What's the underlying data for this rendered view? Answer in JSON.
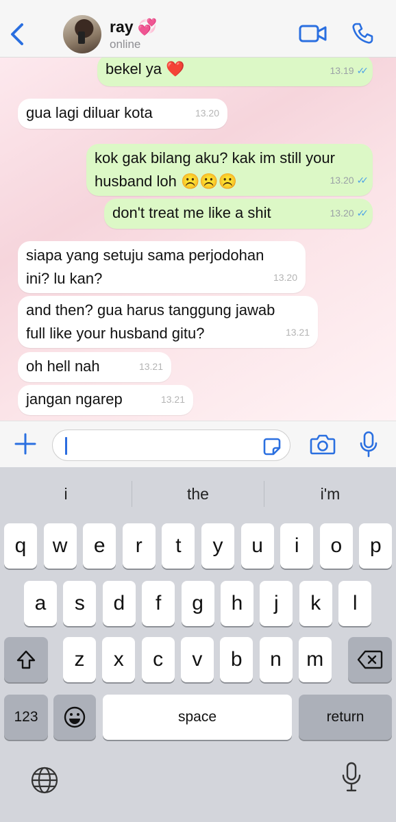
{
  "header": {
    "contact_name": "ray 💞",
    "status": "online",
    "icons": [
      "back-chevron-icon",
      "video-call-icon",
      "phone-call-icon"
    ],
    "accent_color": "#2a6fe0"
  },
  "messages": [
    {
      "side": "out",
      "text": "bekel ya ❤️",
      "time": "13.19",
      "read": true
    },
    {
      "side": "in",
      "text": "gua lagi diluar kota",
      "time": "13.20"
    },
    {
      "side": "out",
      "text": "kok gak bilang aku? kak im still your\nhusband loh ☹️☹️☹️",
      "time": "13.20",
      "read": true
    },
    {
      "side": "out",
      "text": "don't treat me like a shit",
      "time": "13.20",
      "read": true
    },
    {
      "side": "in",
      "text": "siapa yang setuju sama perjodohan\nini? lu kan?",
      "time": "13.20"
    },
    {
      "side": "in",
      "text": "and then? gua harus tanggung jawab\nfull like your husband gitu?",
      "time": "13.21"
    },
    {
      "side": "in",
      "text": "oh hell nah",
      "time": "13.21"
    },
    {
      "side": "in",
      "text": "jangan ngarep",
      "time": "13.21"
    }
  ],
  "input": {
    "value": "",
    "icons": [
      "plus-icon",
      "sticker-icon",
      "camera-icon",
      "microphone-icon"
    ]
  },
  "keyboard": {
    "suggestions": [
      "i",
      "the",
      "i'm"
    ],
    "row1": [
      "q",
      "w",
      "e",
      "r",
      "t",
      "y",
      "u",
      "i",
      "o",
      "p"
    ],
    "row2": [
      "a",
      "s",
      "d",
      "f",
      "g",
      "h",
      "j",
      "k",
      "l"
    ],
    "row3": [
      "z",
      "x",
      "c",
      "v",
      "b",
      "n",
      "m"
    ],
    "numbers_label": "123",
    "space_label": "space",
    "return_label": "return"
  }
}
